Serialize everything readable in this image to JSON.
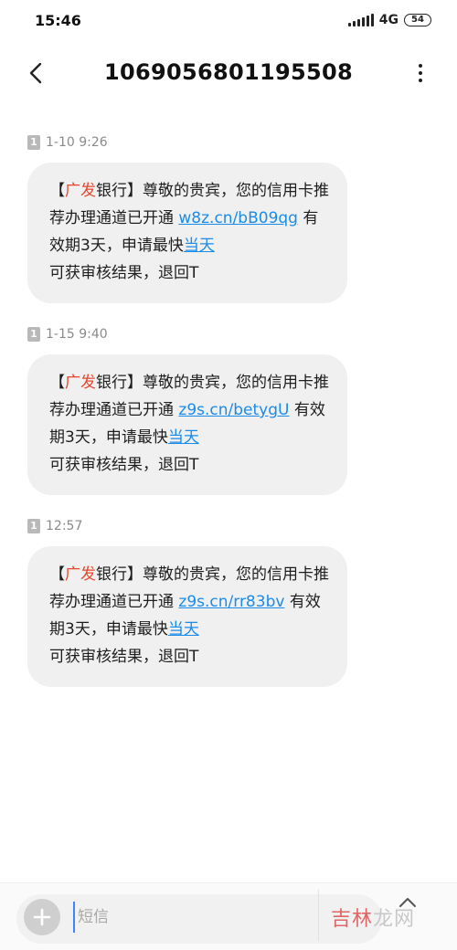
{
  "status_bar": {
    "time": "15:46",
    "network": "4G",
    "battery": "54",
    "icons": [
      "signal-icon",
      "battery-icon"
    ]
  },
  "header": {
    "title": "1069056801195508",
    "icons": [
      "back-arrow-icon",
      "more-vertical-icon"
    ]
  },
  "messages": [
    {
      "sim": "1",
      "time": "1-10 9:26",
      "bracket_open": "【",
      "bank_highlight": "广发",
      "bank_rest": "银行】尊敬的贵宾，您的信用卡推荐办理通道已开通 ",
      "link": "w8z.cn/bB09qg",
      "mid": " 有效期3天，申请最快",
      "today": "当天",
      "tail": "可获审核结果，退回T"
    },
    {
      "sim": "1",
      "time": "1-15 9:40",
      "bracket_open": "【",
      "bank_highlight": "广发",
      "bank_rest": "银行】尊敬的贵宾，您的信用卡推荐办理通道已开通 ",
      "link": "z9s.cn/betygU",
      "mid": " 有效期3天，申请最快",
      "today": "当天",
      "tail": "可获审核结果，退回T"
    },
    {
      "sim": "1",
      "time": "12:57",
      "bracket_open": "【",
      "bank_highlight": "广发",
      "bank_rest": "银行】尊敬的贵宾，您的信用卡推荐办理通道已开通 ",
      "link": "z9s.cn/rr83bv",
      "mid": " 有效期3天，申请最快",
      "today": "当天",
      "tail": "可获审核结果，退回T"
    }
  ],
  "input_bar": {
    "placeholder": "短信",
    "value": "",
    "icons": [
      "plus-icon",
      "send-icon"
    ]
  },
  "watermark": {
    "part1": "吉林",
    "part2": "龙网"
  },
  "colors": {
    "accent_link": "#1a8ce8",
    "brand_red": "#e8462d",
    "bubble": "#f0f0f0"
  }
}
